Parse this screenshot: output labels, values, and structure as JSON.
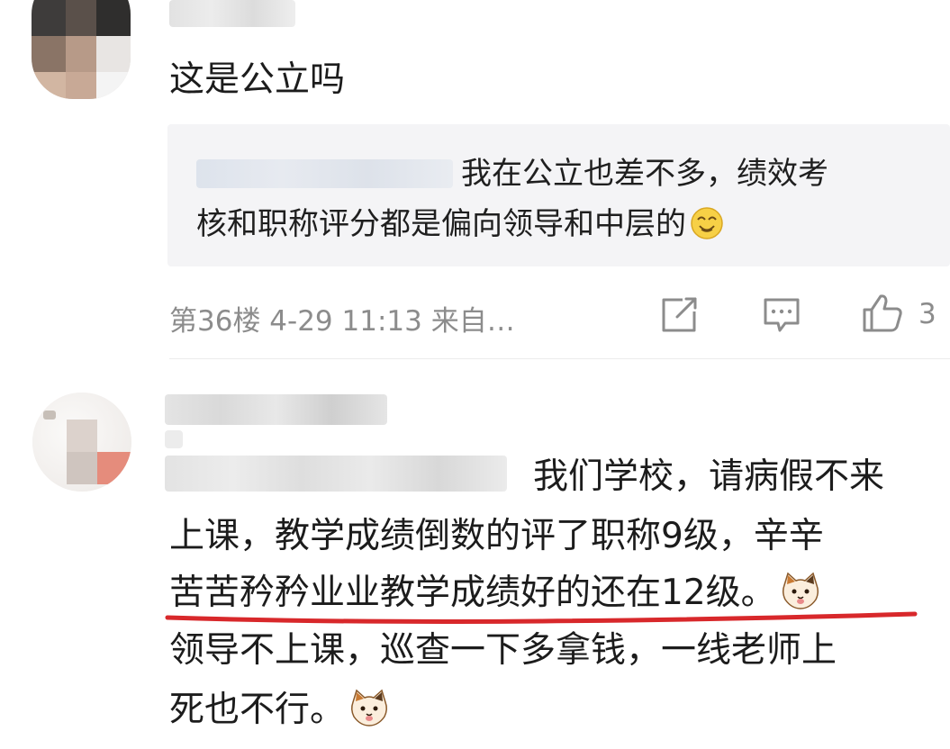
{
  "comment1": {
    "text": "这是公立吗",
    "quote": {
      "line1": "我在公立也差不多，绩效考",
      "line2": "核和职称评分都是偏向领导和中层的"
    },
    "meta": "第36楼 4-29 11:13 来自…",
    "like_count": "3"
  },
  "comment2": {
    "line1": "我们学校，请病假不来",
    "line2": "上课，教学成绩倒数的评了职称9级，辛辛",
    "line3": "苦苦矜矜业业教学成绩好的还在12级。",
    "line4": "领导不上课，巡查一下多拿钱，一线老师上",
    "line5": "死也不行。"
  },
  "icons": {
    "share": "share-icon",
    "reply": "comment-icon",
    "like": "thumbs-up-icon",
    "emoji_smile": "smile-emoji-icon",
    "emoji_cat": "cat-emoji-icon"
  },
  "colors": {
    "annotation_underline": "#d8282b",
    "meta_gray": "#8c8c8c",
    "quote_bg": "#f4f4f6"
  }
}
